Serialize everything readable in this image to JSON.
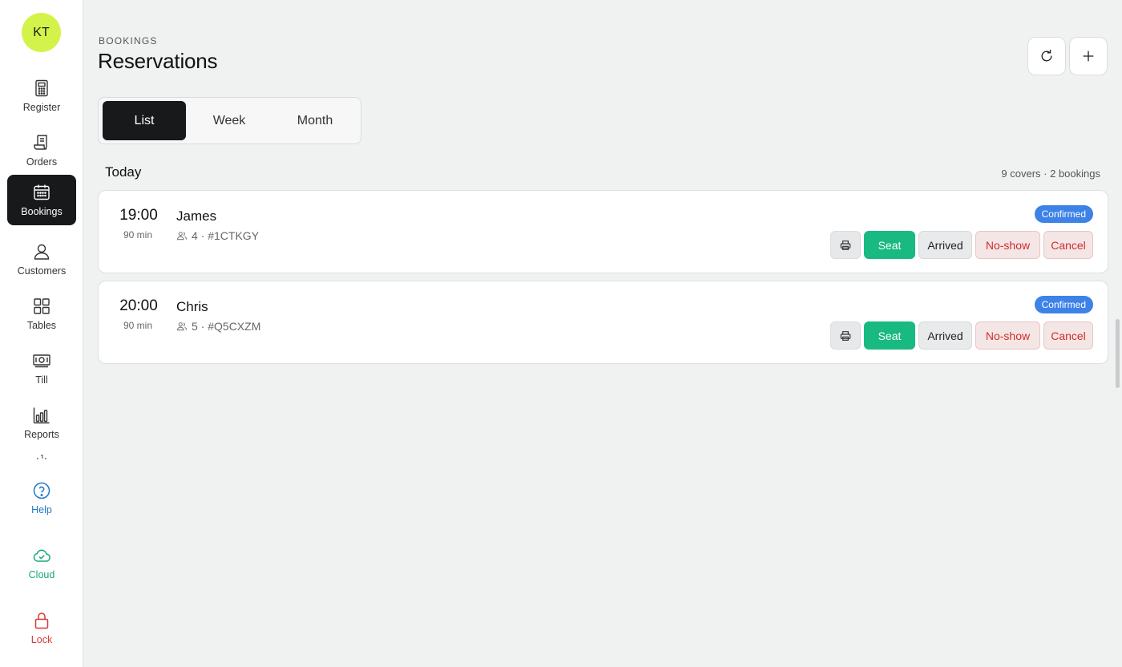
{
  "user": {
    "initials": "KT"
  },
  "sidebar": {
    "items": [
      {
        "label": "Register",
        "icon": "calculator-icon"
      },
      {
        "label": "Orders",
        "icon": "receipt-icon"
      },
      {
        "label": "Bookings",
        "icon": "calendar-icon",
        "active": true
      },
      {
        "label": "Customers",
        "icon": "user-icon"
      },
      {
        "label": "Tables",
        "icon": "grid-icon"
      },
      {
        "label": "Till",
        "icon": "cash-icon"
      },
      {
        "label": "Reports",
        "icon": "bar-chart-icon"
      }
    ],
    "footer": [
      {
        "label": "Help",
        "icon": "help-circle-icon",
        "color": "#1f78c9"
      },
      {
        "label": "Cloud",
        "icon": "cloud-check-icon",
        "color": "#19a97a"
      },
      {
        "label": "Lock",
        "icon": "lock-icon",
        "color": "#d93636"
      }
    ]
  },
  "header": {
    "eyebrow": "BOOKINGS",
    "title": "Reservations",
    "actions": [
      "refresh-icon",
      "plus-icon"
    ]
  },
  "view_tabs": [
    {
      "label": "List",
      "active": true
    },
    {
      "label": "Week"
    },
    {
      "label": "Month"
    }
  ],
  "section": {
    "title": "Today",
    "summary": "9 covers · 2 bookings"
  },
  "bookings": [
    {
      "time": "19:00",
      "duration": "90 min",
      "name": "James",
      "details": "4 · #1CTKGY",
      "status": "Confirmed"
    },
    {
      "time": "20:00",
      "duration": "90 min",
      "name": "Chris",
      "details": "5 · #Q5CXZM",
      "status": "Confirmed"
    }
  ],
  "booking_actions": {
    "seat": "Seat",
    "arrived": "Arrived",
    "no_show": "No-show",
    "cancel": "Cancel"
  },
  "colors": {
    "avatar": "#d4f34a",
    "active_nav": "#17191b",
    "confirmed_badge": "#3d82e6",
    "seat_button": "#19b982",
    "danger": "#d02c2c"
  }
}
